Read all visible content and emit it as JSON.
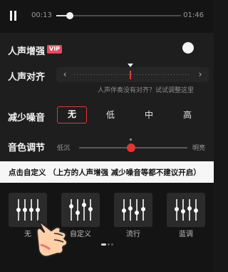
{
  "player": {
    "current_time": "00:13",
    "duration": "01:46",
    "progress_fraction": 0.11
  },
  "settings": {
    "vocal_enhance": {
      "label": "人声增强",
      "vip_badge": "VIP",
      "enabled": false
    },
    "vocal_align": {
      "label": "人声对齐",
      "hint": "人声伴奏没有对齐？试试调整这里",
      "left_arrow": "‹",
      "right_arrow": "›"
    },
    "noise_reduction": {
      "label": "减少噪音",
      "options": [
        "无",
        "低",
        "中",
        "高"
      ],
      "selected_index": 0
    },
    "tone": {
      "label": "音色调节",
      "min_label": "低沉",
      "max_label": "明亮",
      "level_fraction": 0.48,
      "default_fraction": 0.48
    }
  },
  "annotation": {
    "text": "点击自定义 （上方的人声增强 减少噪音等都不建议开启）"
  },
  "presets": {
    "items": [
      {
        "label": "无",
        "knob_levels": [
          0.5,
          0.5,
          0.5,
          0.5
        ]
      },
      {
        "label": "自定义",
        "knob_levels": [
          0.7,
          0.35,
          0.8,
          0.55
        ]
      },
      {
        "label": "流行",
        "knob_levels": [
          0.45,
          0.6,
          0.35,
          0.55
        ]
      },
      {
        "label": "蓝调",
        "knob_levels": [
          0.55,
          0.4,
          0.6,
          0.45
        ]
      }
    ],
    "page_count": 3,
    "active_page": 0
  },
  "colors": {
    "accent_red": "#e23b36",
    "vip_pink": "#e84a5f",
    "banner_bg": "#f6f6f6"
  },
  "icons": [
    "pause-icon",
    "chevron-left-icon",
    "chevron-right-icon",
    "equalizer-icon",
    "pointing-hand-emoji"
  ]
}
